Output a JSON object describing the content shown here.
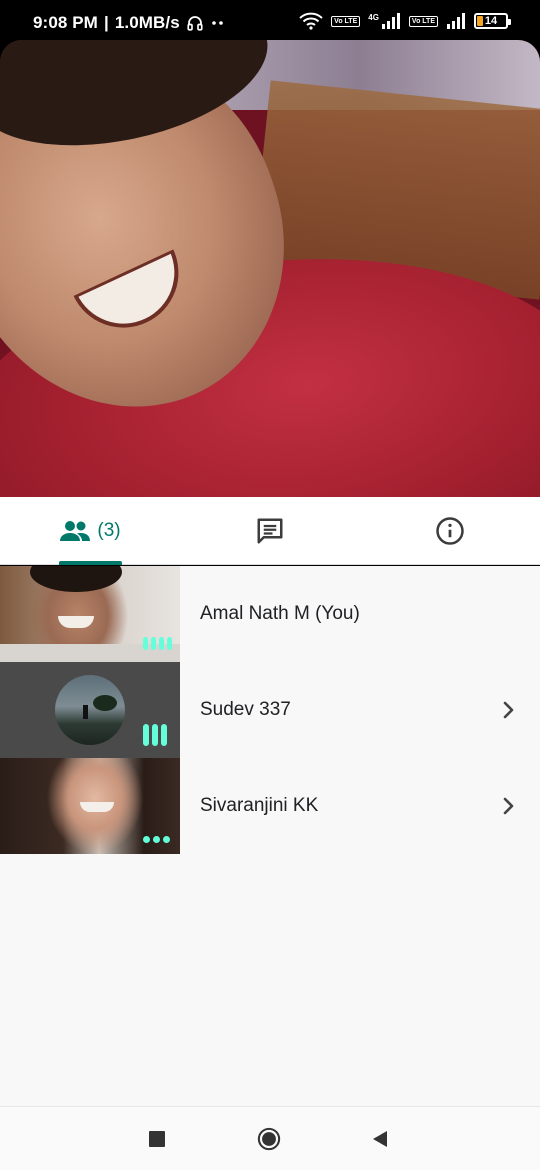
{
  "status_bar": {
    "time": "9:08 PM",
    "separator": "|",
    "speed": "1.0MB/s",
    "network_label": "4G",
    "volte_label": "Vo LTE",
    "battery_level": "14"
  },
  "tabs": {
    "participants_count": "(3)",
    "active": "participants",
    "icons": [
      "people-icon",
      "chat-icon",
      "info-icon"
    ]
  },
  "participants": [
    {
      "name": "Amal Nath M (You)",
      "audio": "speaking",
      "has_chevron": false
    },
    {
      "name": "Sudev 337",
      "audio": "speaking",
      "has_chevron": true
    },
    {
      "name": "Sivaranjini KK",
      "audio": "idle",
      "has_chevron": true
    }
  ],
  "colors": {
    "accent": "#00796b",
    "audio_indicator": "#64ffda",
    "battery_low": "#f5a623"
  },
  "nav_bar": {
    "icons": [
      "recent-apps-icon",
      "home-icon",
      "back-icon"
    ]
  }
}
